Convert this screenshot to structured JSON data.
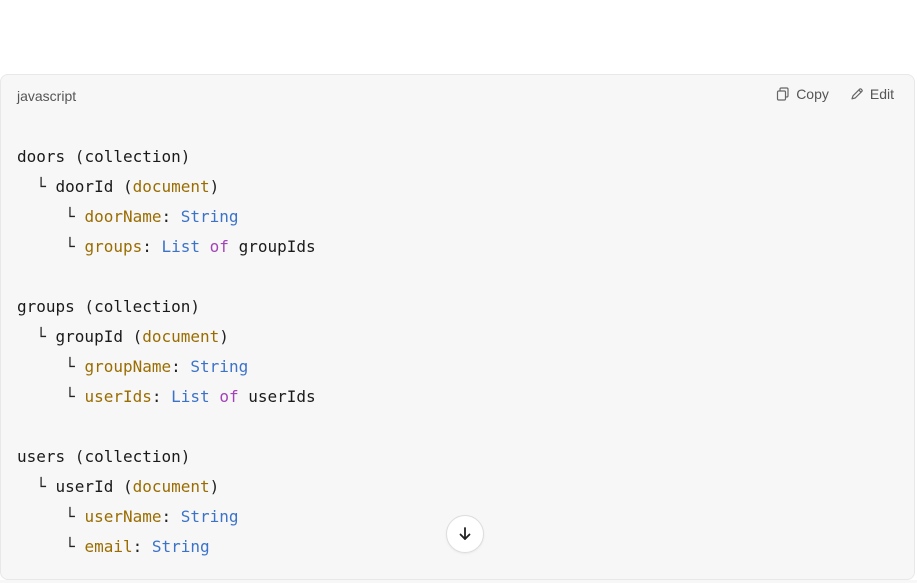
{
  "top_fragment": "'",
  "code_block": {
    "language": "javascript",
    "actions": {
      "copy_label": "Copy",
      "edit_label": "Edit"
    },
    "lines": [
      {
        "kind": "text",
        "indent": 0,
        "tokens": [
          {
            "t": "doors",
            "c": "k-name"
          },
          {
            "t": " (",
            "c": "k-punct"
          },
          {
            "t": "collection",
            "c": "k-name"
          },
          {
            "t": ")",
            "c": "k-punct"
          }
        ]
      },
      {
        "kind": "text",
        "indent": 1,
        "tokens": [
          {
            "t": "└ ",
            "c": "tree-glyph"
          },
          {
            "t": "doorId",
            "c": "k-name"
          },
          {
            "t": " (",
            "c": "k-punct"
          },
          {
            "t": "document",
            "c": "k-doc"
          },
          {
            "t": ")",
            "c": "k-punct"
          }
        ]
      },
      {
        "kind": "text",
        "indent": 2,
        "tokens": [
          {
            "t": "└ ",
            "c": "tree-glyph"
          },
          {
            "t": "doorName",
            "c": "k-field"
          },
          {
            "t": ": ",
            "c": "k-punct"
          },
          {
            "t": "String",
            "c": "k-type"
          }
        ]
      },
      {
        "kind": "text",
        "indent": 2,
        "tokens": [
          {
            "t": "└ ",
            "c": "tree-glyph"
          },
          {
            "t": "groups",
            "c": "k-field"
          },
          {
            "t": ": ",
            "c": "k-punct"
          },
          {
            "t": "List",
            "c": "k-type"
          },
          {
            "t": " ",
            "c": "k-punct"
          },
          {
            "t": "of",
            "c": "k-of"
          },
          {
            "t": " groupIds",
            "c": "k-name"
          }
        ]
      },
      {
        "kind": "blank"
      },
      {
        "kind": "text",
        "indent": 0,
        "tokens": [
          {
            "t": "groups",
            "c": "k-name"
          },
          {
            "t": " (",
            "c": "k-punct"
          },
          {
            "t": "collection",
            "c": "k-name"
          },
          {
            "t": ")",
            "c": "k-punct"
          }
        ]
      },
      {
        "kind": "text",
        "indent": 1,
        "tokens": [
          {
            "t": "└ ",
            "c": "tree-glyph"
          },
          {
            "t": "groupId",
            "c": "k-name"
          },
          {
            "t": " (",
            "c": "k-punct"
          },
          {
            "t": "document",
            "c": "k-doc"
          },
          {
            "t": ")",
            "c": "k-punct"
          }
        ]
      },
      {
        "kind": "text",
        "indent": 2,
        "tokens": [
          {
            "t": "└ ",
            "c": "tree-glyph"
          },
          {
            "t": "groupName",
            "c": "k-field"
          },
          {
            "t": ": ",
            "c": "k-punct"
          },
          {
            "t": "String",
            "c": "k-type"
          }
        ]
      },
      {
        "kind": "text",
        "indent": 2,
        "tokens": [
          {
            "t": "└ ",
            "c": "tree-glyph"
          },
          {
            "t": "userIds",
            "c": "k-field"
          },
          {
            "t": ": ",
            "c": "k-punct"
          },
          {
            "t": "List",
            "c": "k-type"
          },
          {
            "t": " ",
            "c": "k-punct"
          },
          {
            "t": "of",
            "c": "k-of"
          },
          {
            "t": " userIds",
            "c": "k-name"
          }
        ]
      },
      {
        "kind": "blank"
      },
      {
        "kind": "text",
        "indent": 0,
        "tokens": [
          {
            "t": "users",
            "c": "k-name"
          },
          {
            "t": " (",
            "c": "k-punct"
          },
          {
            "t": "collection",
            "c": "k-name"
          },
          {
            "t": ")",
            "c": "k-punct"
          }
        ]
      },
      {
        "kind": "text",
        "indent": 1,
        "tokens": [
          {
            "t": "└ ",
            "c": "tree-glyph"
          },
          {
            "t": "userId",
            "c": "k-name"
          },
          {
            "t": " (",
            "c": "k-punct"
          },
          {
            "t": "document",
            "c": "k-doc"
          },
          {
            "t": ")",
            "c": "k-punct"
          }
        ]
      },
      {
        "kind": "text",
        "indent": 2,
        "tokens": [
          {
            "t": "└ ",
            "c": "tree-glyph"
          },
          {
            "t": "userName",
            "c": "k-field"
          },
          {
            "t": ": ",
            "c": "k-punct"
          },
          {
            "t": "String",
            "c": "k-type"
          }
        ]
      },
      {
        "kind": "text",
        "indent": 2,
        "tokens": [
          {
            "t": "└ ",
            "c": "tree-glyph"
          },
          {
            "t": "email",
            "c": "k-field"
          },
          {
            "t": ": ",
            "c": "k-punct"
          },
          {
            "t": "String",
            "c": "k-type"
          }
        ]
      }
    ]
  },
  "icons": {
    "copy": "copy-icon",
    "edit": "edit-icon",
    "scroll_down": "arrow-down-icon"
  },
  "colors": {
    "code_background": "#f7f7f7",
    "field_key": "#9a6d00",
    "type_keyword": "#3b73c9",
    "of_keyword": "#a343b8"
  }
}
